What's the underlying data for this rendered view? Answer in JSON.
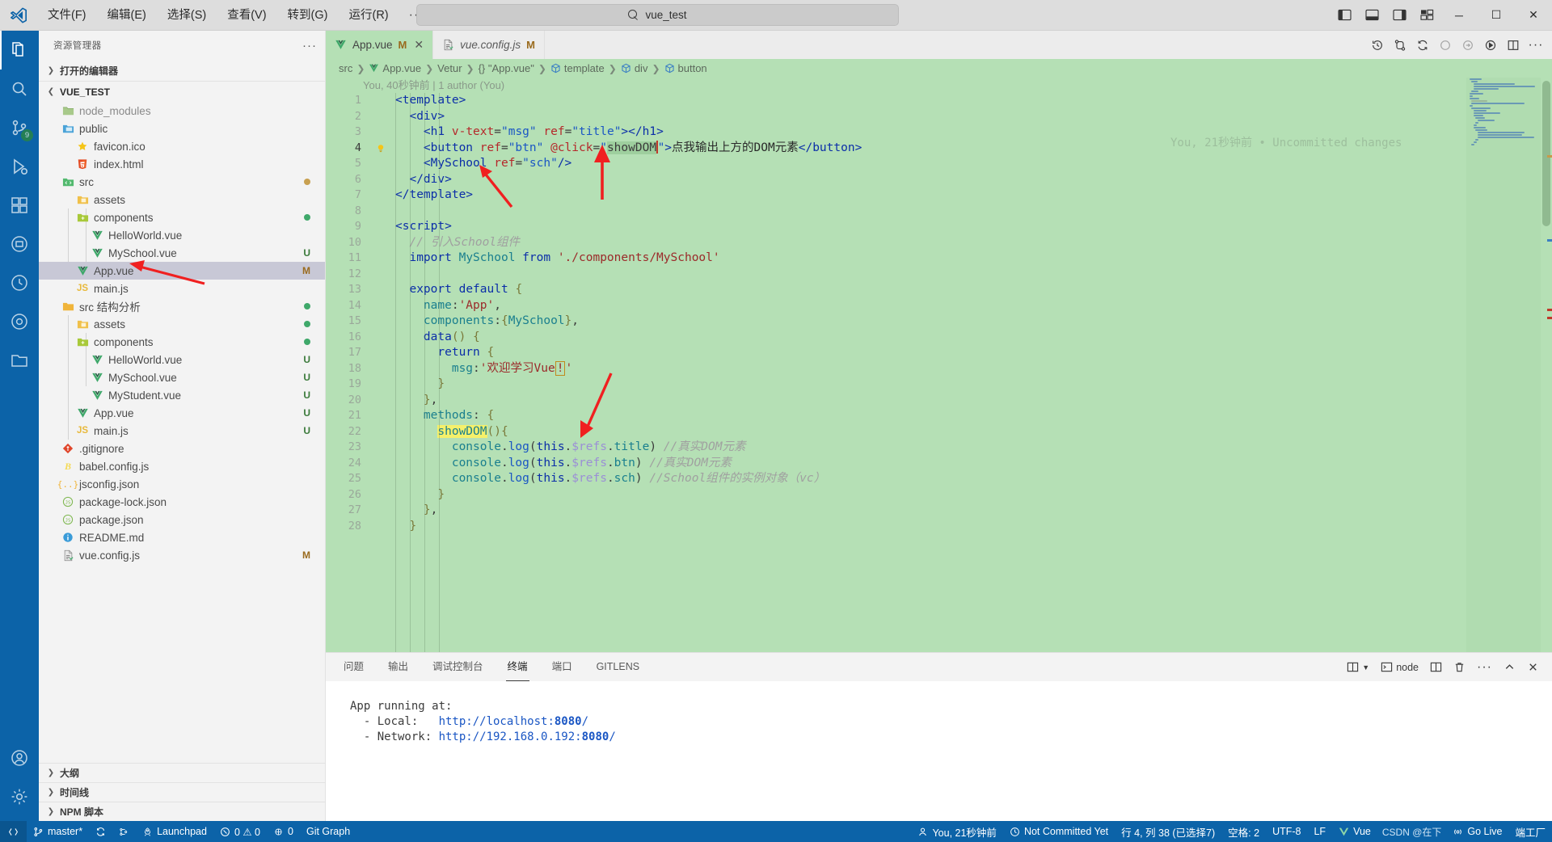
{
  "titlebar": {
    "menus": [
      "文件(F)",
      "编辑(E)",
      "选择(S)",
      "查看(V)",
      "转到(G)",
      "运行(R)"
    ],
    "more": "···",
    "back_icon": "arrow-left-icon",
    "forward_icon": "arrow-right-icon",
    "search_value": "vue_test",
    "search_icon": "search-icon",
    "window_minimize": "─",
    "window_maximize": "☐",
    "window_close": "✕"
  },
  "activitybar": {
    "items": [
      {
        "name": "explorer",
        "icon": "files-icon",
        "badge": ""
      },
      {
        "name": "search",
        "icon": "search-icon",
        "badge": ""
      },
      {
        "name": "source-control",
        "icon": "source-control-icon",
        "badge": "9"
      },
      {
        "name": "run-debug",
        "icon": "debug-icon",
        "badge": ""
      },
      {
        "name": "extensions",
        "icon": "extensions-icon",
        "badge": ""
      },
      {
        "name": "docker",
        "icon": "docker-icon",
        "badge": ""
      },
      {
        "name": "timeline",
        "icon": "clock-icon",
        "badge": ""
      },
      {
        "name": "todo",
        "icon": "circle-icon",
        "badge": ""
      },
      {
        "name": "remote-explorer",
        "icon": "folder-icon",
        "badge": ""
      }
    ],
    "bottom": [
      {
        "name": "accounts",
        "icon": "account-icon"
      },
      {
        "name": "settings",
        "icon": "gear-icon"
      }
    ]
  },
  "sidebar": {
    "title": "资源管理器",
    "more": "···",
    "open_editors": "打开的编辑器",
    "root": "VUE_TEST",
    "tree": [
      {
        "label": "node_modules",
        "indent": 1,
        "icon": "folder",
        "color": "#8a8a8a",
        "badge": ""
      },
      {
        "label": "public",
        "indent": 1,
        "icon": "folder-public",
        "color": "#4a4a4a",
        "badge": ""
      },
      {
        "label": "favicon.ico",
        "indent": 2,
        "icon": "star",
        "color": "#4a4a4a",
        "badge": ""
      },
      {
        "label": "index.html",
        "indent": 2,
        "icon": "html",
        "color": "#4a4a4a",
        "badge": ""
      },
      {
        "label": "src",
        "indent": 1,
        "icon": "folder-src",
        "color": "#4a4a4a",
        "badge": "dot-orange"
      },
      {
        "label": "assets",
        "indent": 2,
        "icon": "folder-assets",
        "color": "#4a4a4a",
        "badge": ""
      },
      {
        "label": "components",
        "indent": 2,
        "icon": "folder-components",
        "color": "#4a4a4a",
        "badge": "dot-green"
      },
      {
        "label": "HelloWorld.vue",
        "indent": 3,
        "icon": "vue",
        "color": "#4a4a4a",
        "badge": ""
      },
      {
        "label": "MySchool.vue",
        "indent": 3,
        "icon": "vue",
        "color": "#4a4a4a",
        "badge": "U"
      },
      {
        "label": "App.vue",
        "indent": 2,
        "icon": "vue",
        "color": "#4a4a4a",
        "badge": "M",
        "selected": true
      },
      {
        "label": "main.js",
        "indent": 2,
        "icon": "js",
        "color": "#4a4a4a",
        "badge": ""
      },
      {
        "label": "src 结构分析",
        "indent": 1,
        "icon": "folder-plain",
        "color": "#4a4a4a",
        "badge": "dot-green"
      },
      {
        "label": "assets",
        "indent": 2,
        "icon": "folder-assets",
        "color": "#4a4a4a",
        "badge": "dot-green"
      },
      {
        "label": "components",
        "indent": 2,
        "icon": "folder-components",
        "color": "#4a4a4a",
        "badge": "dot-green"
      },
      {
        "label": "HelloWorld.vue",
        "indent": 3,
        "icon": "vue",
        "color": "#4a4a4a",
        "badge": "U"
      },
      {
        "label": "MySchool.vue",
        "indent": 3,
        "icon": "vue",
        "color": "#4a4a4a",
        "badge": "U"
      },
      {
        "label": "MyStudent.vue",
        "indent": 3,
        "icon": "vue",
        "color": "#4a4a4a",
        "badge": "U"
      },
      {
        "label": "App.vue",
        "indent": 2,
        "icon": "vue",
        "color": "#4a4a4a",
        "badge": "U"
      },
      {
        "label": "main.js",
        "indent": 2,
        "icon": "js",
        "color": "#4a4a4a",
        "badge": "U"
      },
      {
        "label": ".gitignore",
        "indent": 1,
        "icon": "git",
        "color": "#4a4a4a",
        "badge": ""
      },
      {
        "label": "babel.config.js",
        "indent": 1,
        "icon": "babel",
        "color": "#4a4a4a",
        "badge": ""
      },
      {
        "label": "jsconfig.json",
        "indent": 1,
        "icon": "jsconfig",
        "color": "#4a4a4a",
        "badge": ""
      },
      {
        "label": "package-lock.json",
        "indent": 1,
        "icon": "npm",
        "color": "#4a4a4a",
        "badge": ""
      },
      {
        "label": "package.json",
        "indent": 1,
        "icon": "npm",
        "color": "#4a4a4a",
        "badge": ""
      },
      {
        "label": "README.md",
        "indent": 1,
        "icon": "info",
        "color": "#4a4a4a",
        "badge": ""
      },
      {
        "label": "vue.config.js",
        "indent": 1,
        "icon": "vueconfig",
        "color": "#4a4a4a",
        "badge": "M"
      }
    ],
    "footer": [
      "大纲",
      "时间线",
      "NPM 脚本"
    ]
  },
  "editor": {
    "tabs": [
      {
        "name": "App.vue",
        "icon": "vue-icon",
        "modified": "M",
        "active": true,
        "italic": false,
        "closable": true
      },
      {
        "name": "vue.config.js",
        "icon": "vueconfig-icon",
        "modified": "M",
        "active": false,
        "italic": true,
        "closable": false
      }
    ],
    "tab_actions": [
      "history-icon",
      "compare-icon",
      "sync-icon",
      "circle-icon",
      "arrow-circle-icon",
      "run-icon",
      "split-editor-icon",
      "more-icon"
    ],
    "breadcrumb": [
      "src",
      "App.vue",
      "Vetur",
      "{} \"App.vue\"",
      "template",
      "div",
      "button"
    ],
    "blame": "You, 40秒钟前 | 1 author (You)",
    "uncommitted": "You, 21秒钟前 • Uncommitted changes",
    "lines": [
      {
        "n": 1,
        "code": "<template>"
      },
      {
        "n": 2,
        "code": "  <div>"
      },
      {
        "n": 3,
        "code": "    <h1 v-text=\"msg\" ref=\"title\"></h1>"
      },
      {
        "n": 4,
        "code": "    <button ref=\"btn\" @click=\"showDOM\">点我输出上方的DOM元素</button>",
        "current": true,
        "bulb": true
      },
      {
        "n": 5,
        "code": "    <MySchool ref=\"sch\"/>"
      },
      {
        "n": 6,
        "code": "  </div>"
      },
      {
        "n": 7,
        "code": "</template>"
      },
      {
        "n": 8,
        "code": ""
      },
      {
        "n": 9,
        "code": "<script>"
      },
      {
        "n": 10,
        "code": "  // 引入School组件"
      },
      {
        "n": 11,
        "code": "  import MySchool from './components/MySchool'"
      },
      {
        "n": 12,
        "code": ""
      },
      {
        "n": 13,
        "code": "  export default {"
      },
      {
        "n": 14,
        "code": "    name:'App',"
      },
      {
        "n": 15,
        "code": "    components:{MySchool},"
      },
      {
        "n": 16,
        "code": "    data() {"
      },
      {
        "n": 17,
        "code": "      return {"
      },
      {
        "n": 18,
        "code": "        msg:'欢迎学习Vue!'"
      },
      {
        "n": 19,
        "code": "      }"
      },
      {
        "n": 20,
        "code": "    },"
      },
      {
        "n": 21,
        "code": "    methods: {"
      },
      {
        "n": 22,
        "code": "      showDOM(){"
      },
      {
        "n": 23,
        "code": "        console.log(this.$refs.title) //真实DOM元素"
      },
      {
        "n": 24,
        "code": "        console.log(this.$refs.btn) //真实DOM元素"
      },
      {
        "n": 25,
        "code": "        console.log(this.$refs.sch) //School组件的实例对象（vc）"
      },
      {
        "n": 26,
        "code": "      }"
      },
      {
        "n": 27,
        "code": "    },"
      },
      {
        "n": 28,
        "code": "  }"
      }
    ]
  },
  "panel": {
    "tabs": [
      "问题",
      "输出",
      "调试控制台",
      "终端",
      "端口",
      "GITLENS"
    ],
    "active_tab": "终端",
    "shell_label": "node",
    "actions": [
      "split-panel-icon",
      "new-terminal-icon",
      "split-terminal-icon",
      "trash-icon",
      "more-icon",
      "chevron-up-icon",
      "close-icon"
    ],
    "terminal_lines": [
      {
        "text": "App running at:",
        "type": "plain"
      },
      {
        "text": "  - Local:   http://localhost:8080/",
        "type": "local"
      },
      {
        "text": "  - Network: http://192.168.0.192:8080/",
        "type": "network"
      }
    ]
  },
  "statusbar": {
    "left": [
      {
        "name": "remote-indicator",
        "label": "",
        "icon": "remote-icon"
      },
      {
        "name": "branch",
        "label": "master*",
        "icon": "branch-icon"
      },
      {
        "name": "sync",
        "label": "",
        "icon": "sync-icon"
      },
      {
        "name": "gitlens-graph",
        "label": "",
        "icon": "graph-icon"
      },
      {
        "name": "launchpad",
        "label": "Launchpad",
        "icon": "rocket-icon"
      },
      {
        "name": "problems",
        "label": "0  ⚠ 0",
        "icon": "error-icon"
      },
      {
        "name": "ports",
        "label": "0",
        "icon": "ports-icon"
      },
      {
        "name": "git-graph",
        "label": "Git Graph",
        "icon": ""
      }
    ],
    "right": [
      {
        "name": "blame",
        "label": "You, 21秒钟前",
        "icon": "person-icon"
      },
      {
        "name": "commit-status",
        "label": "Not Committed Yet",
        "icon": "clock-icon"
      },
      {
        "name": "cursor-position",
        "label": "行 4, 列 38 (已选择7)",
        "icon": ""
      },
      {
        "name": "indentation",
        "label": "空格: 2",
        "icon": ""
      },
      {
        "name": "encoding",
        "label": "UTF-8",
        "icon": ""
      },
      {
        "name": "eol",
        "label": "LF",
        "icon": ""
      },
      {
        "name": "language-mode",
        "label": "Vue",
        "icon": ""
      },
      {
        "name": "watermark",
        "label": "CSDN @在下",
        "icon": ""
      },
      {
        "name": "go-live",
        "label": "Go Live",
        "icon": "broadcast-icon"
      },
      {
        "name": "prettier",
        "label": "端工厂",
        "icon": ""
      }
    ]
  },
  "colors": {
    "accent": "#0c63a8",
    "editor_bg": "#b5e0b5",
    "tab_active": "#b5e0b5",
    "arrow": "#f02020"
  }
}
